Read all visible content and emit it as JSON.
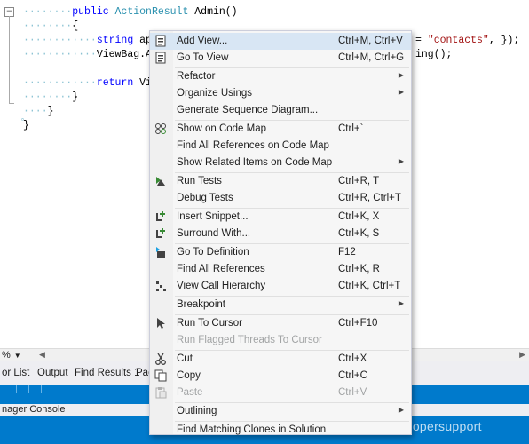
{
  "editor": {
    "lines": [
      {
        "indent": "········",
        "parts": [
          {
            "t": "public ",
            "c": "kw"
          },
          {
            "t": "ActionResult",
            "c": "ty"
          },
          {
            "t": " Admin()",
            "c": ""
          }
        ]
      },
      {
        "indent": "········",
        "parts": [
          {
            "t": "{",
            "c": ""
          }
        ]
      },
      {
        "indent": "············",
        "parts": [
          {
            "t": "string ",
            "c": "kw"
          },
          {
            "t": "apiUr",
            "c": ""
          }
        ]
      },
      {
        "indent": "············",
        "parts": [
          {
            "t": "ViewBag.ApiU",
            "c": ""
          }
        ]
      },
      {
        "indent": "",
        "parts": []
      },
      {
        "indent": "············",
        "parts": [
          {
            "t": "return ",
            "c": "kw"
          },
          {
            "t": "View(",
            "c": ""
          }
        ]
      },
      {
        "indent": "········",
        "parts": [
          {
            "t": "}",
            "c": ""
          }
        ]
      },
      {
        "indent": "····",
        "parts": [
          {
            "t": "}",
            "c": ""
          }
        ]
      },
      {
        "indent": "",
        "parts": [
          {
            "t": "}",
            "c": ""
          }
        ]
      }
    ],
    "right_line1_pre": "= ",
    "right_line1_str": "\"contacts\"",
    "right_line1_post": ", });",
    "right_line2": "ing();",
    "caret_glyph": "▫",
    "fold_glyph": "−"
  },
  "hscroll": {
    "zoom": "%",
    "zoom_arrow": "▼",
    "left_arrow": "◀",
    "right_arrow": "▶"
  },
  "tabs": [
    "or List",
    "Output",
    "Find Results 1",
    "Pac"
  ],
  "package_manager": "nager Console",
  "watermark": "http://www.cnblogs.com/developersupport",
  "menu": {
    "items": [
      {
        "label": "Add View...",
        "shortcut": "Ctrl+M, Ctrl+V",
        "icon": "add-view-icon",
        "highlight": true
      },
      {
        "label": "Go To View",
        "shortcut": "Ctrl+M, Ctrl+G",
        "icon": "go-to-view-icon"
      },
      {
        "sep": true
      },
      {
        "label": "Refactor",
        "submenu": true
      },
      {
        "label": "Organize Usings",
        "submenu": true
      },
      {
        "label": "Generate Sequence Diagram..."
      },
      {
        "sep": true
      },
      {
        "label": "Show on Code Map",
        "shortcut": "Ctrl+`",
        "icon": "code-map-icon"
      },
      {
        "label": "Find All References on Code Map"
      },
      {
        "label": "Show Related Items on Code Map",
        "submenu": true
      },
      {
        "sep": true
      },
      {
        "label": "Run Tests",
        "shortcut": "Ctrl+R, T",
        "icon": "run-tests-icon"
      },
      {
        "label": "Debug Tests",
        "shortcut": "Ctrl+R, Ctrl+T"
      },
      {
        "sep": true
      },
      {
        "label": "Insert Snippet...",
        "shortcut": "Ctrl+K, X",
        "icon": "insert-snippet-icon"
      },
      {
        "label": "Surround With...",
        "shortcut": "Ctrl+K, S",
        "icon": "surround-with-icon"
      },
      {
        "sep": true
      },
      {
        "label": "Go To Definition",
        "shortcut": "F12",
        "icon": "go-to-definition-icon"
      },
      {
        "label": "Find All References",
        "shortcut": "Ctrl+K, R"
      },
      {
        "label": "View Call Hierarchy",
        "shortcut": "Ctrl+K, Ctrl+T",
        "icon": "call-hierarchy-icon"
      },
      {
        "sep": true
      },
      {
        "label": "Breakpoint",
        "submenu": true
      },
      {
        "sep": true
      },
      {
        "label": "Run To Cursor",
        "shortcut": "Ctrl+F10",
        "icon": "run-to-cursor-icon"
      },
      {
        "label": "Run Flagged Threads To Cursor",
        "disabled": true
      },
      {
        "sep": true
      },
      {
        "label": "Cut",
        "shortcut": "Ctrl+X",
        "icon": "cut-icon"
      },
      {
        "label": "Copy",
        "shortcut": "Ctrl+C",
        "icon": "copy-icon"
      },
      {
        "label": "Paste",
        "shortcut": "Ctrl+V",
        "icon": "paste-icon",
        "disabled": true
      },
      {
        "sep": true
      },
      {
        "label": "Outlining",
        "submenu": true
      },
      {
        "sep": true
      },
      {
        "label": "Find Matching Clones in Solution"
      }
    ],
    "submenu_glyph": "▶"
  }
}
